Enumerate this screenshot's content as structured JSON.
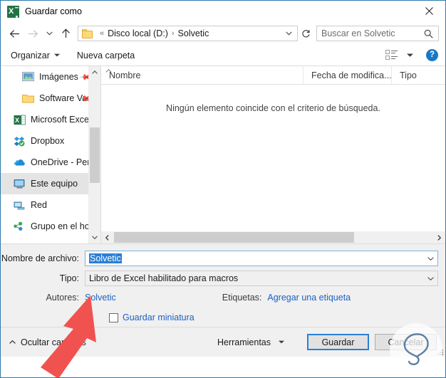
{
  "window": {
    "title": "Guardar como",
    "app_icon": "excel-icon",
    "close_label": "✕"
  },
  "nav": {
    "back": "back-arrow",
    "forward": "forward-arrow",
    "recent": "recent-chevron",
    "up": "up-arrow",
    "refresh": "refresh-icon"
  },
  "address": {
    "folder_icon": "folder-icon",
    "prefix": "«",
    "crumbs": [
      "Disco local (D:)",
      "Solvetic"
    ],
    "separator": "›",
    "dropdown": "chevron-down-icon"
  },
  "search": {
    "placeholder": "Buscar en Solvetic",
    "icon": "search-icon"
  },
  "toolbar": {
    "organize": "Organizar",
    "new_folder": "Nueva carpeta",
    "view_icon": "view-layout-icon",
    "view_caret": "chevron-down-icon",
    "help": "?"
  },
  "sidebar": {
    "items": [
      {
        "label": "Imágenes",
        "icon": "pictures-icon",
        "indent": true,
        "pinned": true,
        "selected": false
      },
      {
        "label": "Software Vari",
        "icon": "folder-icon",
        "indent": true,
        "pinned": true,
        "selected": false
      },
      {
        "label": "Microsoft Excel",
        "icon": "excel-icon",
        "indent": false,
        "pinned": false,
        "selected": false
      },
      {
        "label": "Dropbox",
        "icon": "dropbox-icon",
        "indent": false,
        "pinned": false,
        "selected": false
      },
      {
        "label": "OneDrive - Person",
        "icon": "onedrive-icon",
        "indent": false,
        "pinned": false,
        "selected": false
      },
      {
        "label": "Este equipo",
        "icon": "this-pc-icon",
        "indent": false,
        "pinned": false,
        "selected": true
      },
      {
        "label": "Red",
        "icon": "network-icon",
        "indent": false,
        "pinned": false,
        "selected": false
      },
      {
        "label": "Grupo en el hogar",
        "icon": "homegroup-icon",
        "indent": false,
        "pinned": false,
        "selected": false
      }
    ]
  },
  "filelist": {
    "columns": [
      "Nombre",
      "Fecha de modifica...",
      "Tipo"
    ],
    "sort_indicator": "sort-ascending-icon",
    "empty_message": "Ningún elemento coincide con el criterio de búsqueda."
  },
  "form": {
    "filename_label": "Nombre de archivo:",
    "filename_value": "Solvetic",
    "filetype_label": "Tipo:",
    "filetype_value": "Libro de Excel habilitado para macros",
    "authors_label": "Autores:",
    "authors_value": "Solvetic",
    "tags_label": "Etiquetas:",
    "tags_value": "Agregar una etiqueta",
    "thumbnail_label": "Guardar miniatura",
    "thumbnail_checked": false
  },
  "footer": {
    "hide_folders": "Ocultar carpetas",
    "tools": "Herramientas",
    "save": "Guardar",
    "cancel": "Cancelar"
  },
  "colors": {
    "window_border": "#2b7cad",
    "accent_blue": "#2a7fd4",
    "link_blue": "#1a61c4",
    "selection_blue": "#2a7fd4",
    "excel_green": "#217346",
    "annotation_red": "#f0534f",
    "panel_grey": "#f0f0f0"
  }
}
